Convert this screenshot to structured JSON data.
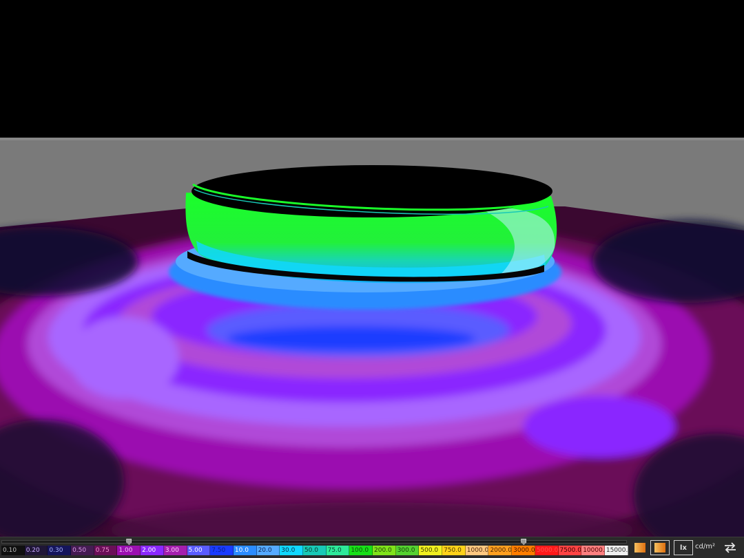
{
  "scene": {
    "description_label": "Luminance false-color render viewport"
  },
  "scale": {
    "values": [
      "0.10",
      "0.20",
      "0.30",
      "0.50",
      "0.75",
      "1.00",
      "2.00",
      "3.00",
      "5.00",
      "7.50",
      "10.0",
      "20.0",
      "30.0",
      "50.0",
      "75.0",
      "100.0",
      "200.0",
      "300.0",
      "500.0",
      "750.0",
      "1000.0",
      "2000.0",
      "3000.0",
      "5000.0",
      "7500.0",
      "10000.0",
      "15000.0"
    ],
    "colors": [
      "#101010",
      "#1f1636",
      "#15155c",
      "#451c52",
      "#6a0f58",
      "#9b10b0",
      "#8a28ff",
      "#a41fae",
      "#5a5cff",
      "#1a3cff",
      "#2b8cff",
      "#55aaff",
      "#10d8ff",
      "#18c9b6",
      "#2dea9a",
      "#18e018",
      "#7fe31a",
      "#55d230",
      "#f0f020",
      "#ffd21a",
      "#ffc880",
      "#ffa020",
      "#ff7e00",
      "#ff1a1a",
      "#ff4444",
      "#ff8080",
      "#f0f0f0"
    ],
    "text_colors": [
      "#b8b8b8",
      "#c8a8ff",
      "#a8b4ff",
      "#d898e8",
      "#f090d0",
      "#f7c2ff",
      "#ffffff",
      "#ffd0ff",
      "#ffffff",
      "#0a1e8a",
      "#ffffff",
      "#0c2250",
      "#083040",
      "#0a3a2e",
      "#0a4030",
      "#0a4a0a",
      "#204008",
      "#123d0a",
      "#404000",
      "#4a3a00",
      "#4a2a10",
      "#4a2400",
      "#4a1a00",
      "#ff5050",
      "#3a0000",
      "#4a0000",
      "#303030"
    ],
    "low_handle_value": "1.00",
    "high_handle_value": "3000.0"
  },
  "toolbar": {
    "palette_a_icon": "gradient-palette-icon",
    "palette_b_icon": "gradient-palette-selected-icon",
    "lux_label": "lx",
    "unit_label": "cd/m²",
    "swap_icon": "swap-arrows-icon"
  },
  "colors": {
    "accent_orange": "#e8a040",
    "bar_bg": "#2a2a2a"
  }
}
